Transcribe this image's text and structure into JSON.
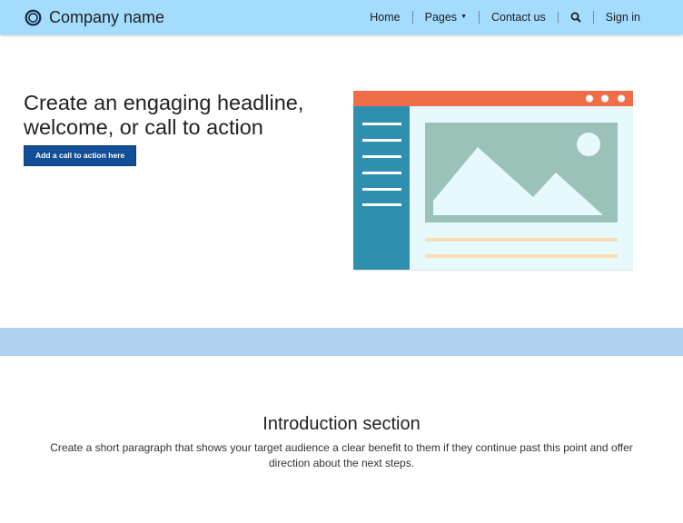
{
  "header": {
    "brand_name": "Company name",
    "nav": {
      "home": "Home",
      "pages": "Pages",
      "contact": "Contact us",
      "signin": "Sign in"
    }
  },
  "hero": {
    "headline": "Create an engaging headline, welcome, or call to action",
    "cta_label": "Add a call to action here"
  },
  "intro": {
    "title": "Introduction section",
    "body": "Create a short paragraph that shows your target audience a clear benefit to them if they continue past this point and offer direction about the next steps."
  },
  "icons": {
    "logo": "company-logo-ring",
    "search": "search-icon",
    "pages_dropdown": "caret-down-icon"
  },
  "colors": {
    "navbar": "#a3dcfd",
    "cta": "#124f96",
    "band": "#aed1ef",
    "illustration_titlebar": "#ef6d47",
    "illustration_sidebar": "#2e8fae",
    "illustration_image": "#9bc2b8"
  }
}
